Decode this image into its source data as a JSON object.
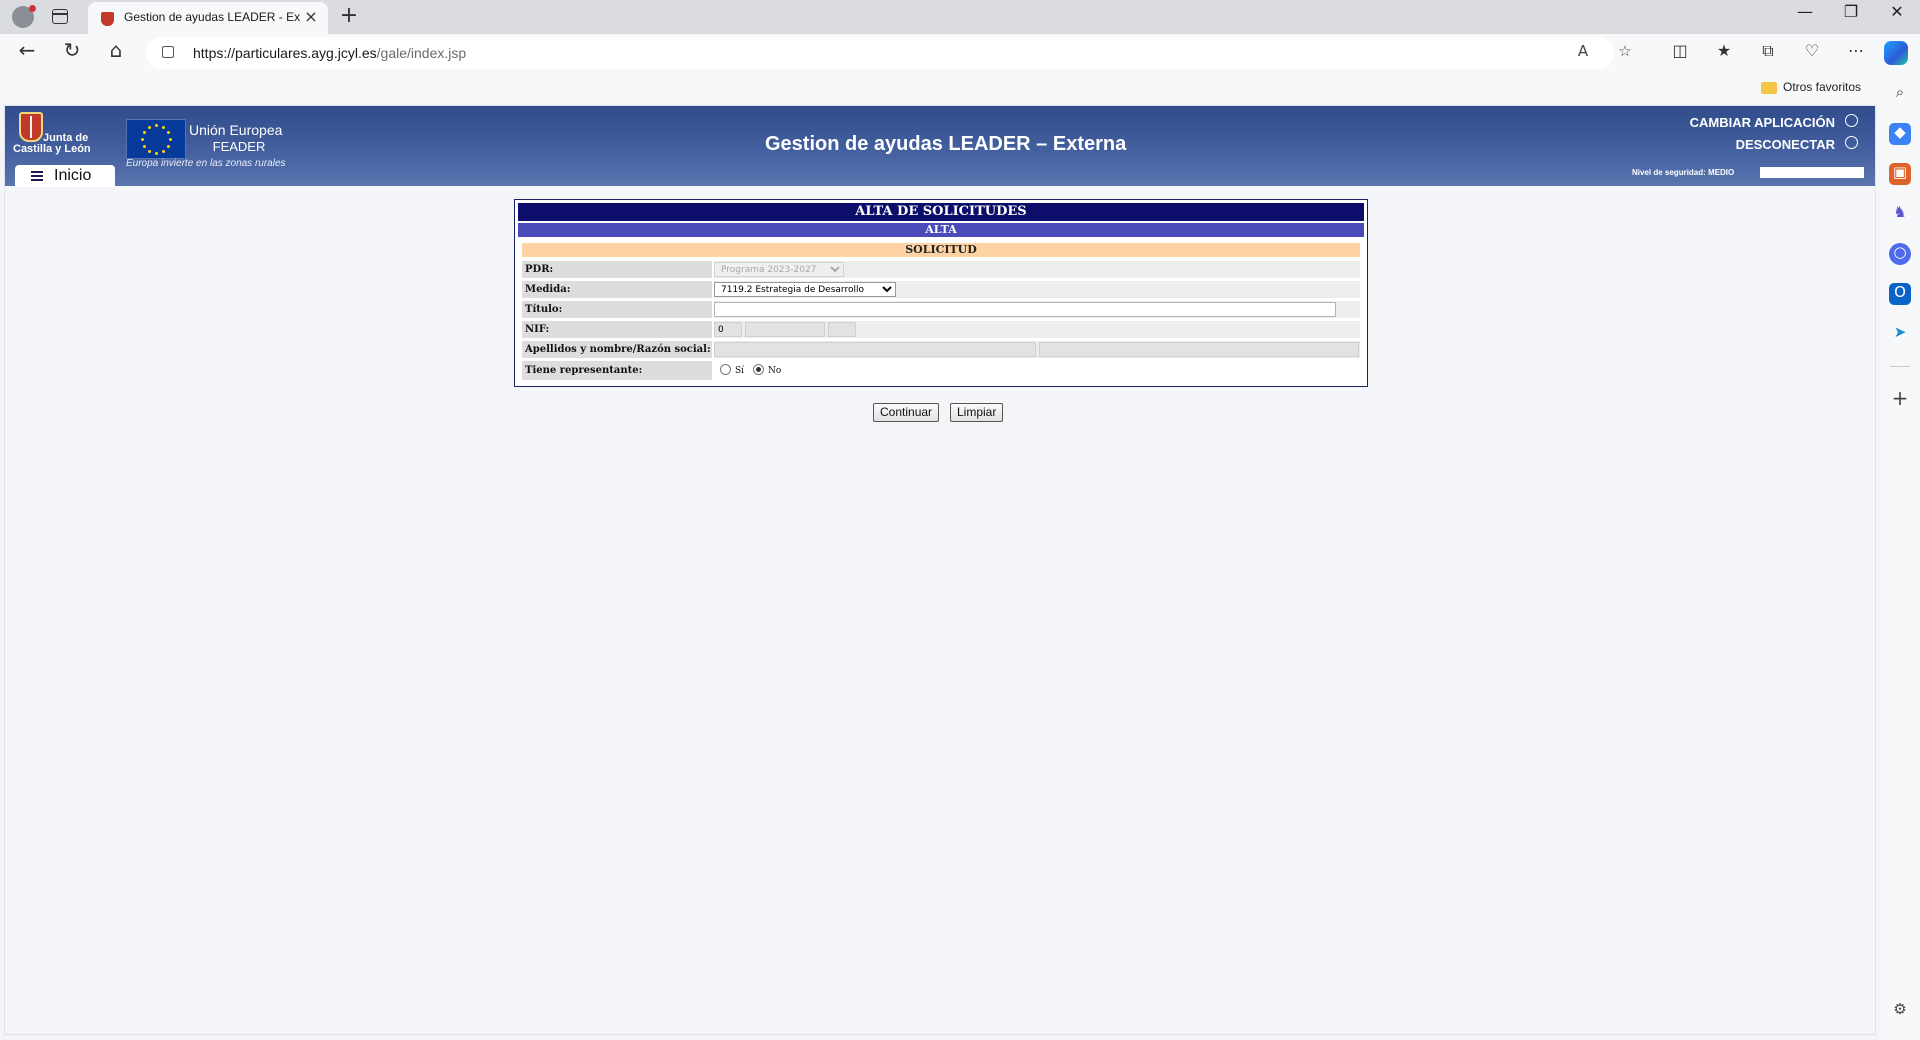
{
  "browser": {
    "tab_title": "Gestion de ayudas LEADER - Externa",
    "new_tab": "+",
    "url_host": "https://particulares.ayg.jcyl.es",
    "url_path": "/gale/index.jsp",
    "favorites_folder": "Otros favoritos",
    "window_controls": {
      "minimize": "—",
      "restore": "❐",
      "close": "✕"
    },
    "icons": {
      "back": "arrow-left-icon",
      "refresh": "refresh-icon",
      "home": "home-icon",
      "read_aloud": "read-aloud-icon",
      "favorite": "star-icon",
      "split": "split-screen-icon",
      "favorites": "favorites-icon",
      "collections": "collections-icon",
      "performance": "heart-pulse-icon",
      "menu": "more-icon",
      "copilot": "copilot-icon"
    }
  },
  "header": {
    "jcyl_line1": "Junta de",
    "jcyl_line2": "Castilla y León",
    "eu_name": "Unión Europea",
    "eu_fund": "FEADER",
    "eu_motto": "Europa invierte en las zonas rurales",
    "app_title": "Gestion de ayudas LEADER – Externa",
    "change_app": "CAMBIAR APLICACIÓN",
    "logout": "DESCONECTAR",
    "security_label": "Nivel de seguridad:",
    "security_value": "MEDIO",
    "home_tab": "Inicio"
  },
  "form": {
    "title": "ALTA DE SOLICITUDES",
    "subtitle": "ALTA",
    "section": "SOLICITUD",
    "pdr_label": "PDR:",
    "pdr_value": "Programa 2023-2027",
    "medida_label": "Medida:",
    "medida_value": "7119.2 Estrategia de Desarrollo",
    "titulo_label": "Título:",
    "titulo_value": "",
    "nif_label": "NIF:",
    "nif_type": "0",
    "nif_number": "",
    "nif_letter": "",
    "nombre_label": "Apellidos y nombre/Razón social:",
    "nombre_value": "",
    "representante_label": "Tiene representante:",
    "representante_si": "Sí",
    "representante_no": "No",
    "representante_selected": "No"
  },
  "actions": {
    "continue": "Continuar",
    "clear": "Limpiar"
  }
}
